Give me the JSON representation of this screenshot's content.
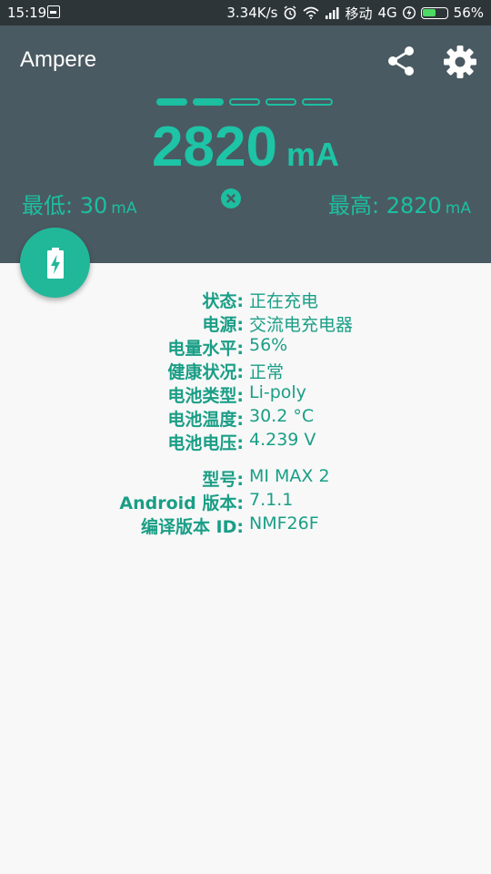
{
  "status_bar": {
    "time": "15:19",
    "net_speed": "3.34K/s",
    "carrier": "移动",
    "network_type": "4G",
    "battery_percent": "56%",
    "battery_level": 0.56,
    "battery_color": "#4cd964",
    "icons": [
      "notification-icon",
      "alarm-icon",
      "wifi-icon",
      "signal-icon",
      "charging-icon",
      "battery-icon"
    ]
  },
  "header": {
    "app_title": "Ampere",
    "share_icon": "share-icon",
    "settings_icon": "gear-icon",
    "pages": {
      "total": 5,
      "active": 2
    },
    "current_value": "2820",
    "current_unit": "mA",
    "min_label": "最低: 30",
    "min_unit": "mA",
    "max_label": "最高: 2820",
    "max_unit": "mA",
    "reset_icon": "close-icon",
    "accent_color": "#1dc4a6",
    "background_color": "#4a5a62"
  },
  "fab": {
    "icon": "battery-charging-icon",
    "color": "#21b89a"
  },
  "battery_info": [
    {
      "key": "状态:",
      "value": "正在充电"
    },
    {
      "key": "电源:",
      "value": "交流电充电器"
    },
    {
      "key": "电量水平:",
      "value": "56%"
    },
    {
      "key": "健康状况:",
      "value": "正常"
    },
    {
      "key": "电池类型:",
      "value": "Li-poly"
    },
    {
      "key": "电池温度:",
      "value": "30.2 °C"
    },
    {
      "key": "电池电压:",
      "value": "4.239 V"
    }
  ],
  "device_info": [
    {
      "key": "型号:",
      "value": "MI MAX 2"
    },
    {
      "key": "Android 版本:",
      "value": "7.1.1"
    },
    {
      "key": "编译版本 ID:",
      "value": "NMF26F"
    }
  ]
}
